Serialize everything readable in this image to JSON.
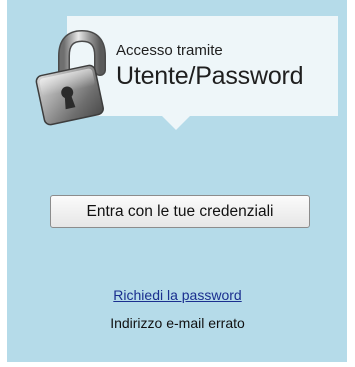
{
  "header": {
    "subtitle": "Accesso tramite",
    "title": "Utente/Password",
    "icon": "padlock-icon"
  },
  "login": {
    "button_label": "Entra con le tue credenziali"
  },
  "links": {
    "request_password": "Richiedi la password"
  },
  "status": {
    "error_message": "Indirizzo e-mail errato"
  },
  "colors": {
    "panel_background": "#b5dbe9",
    "header_card": "#eef6f9",
    "link": "#1a2f8f"
  }
}
